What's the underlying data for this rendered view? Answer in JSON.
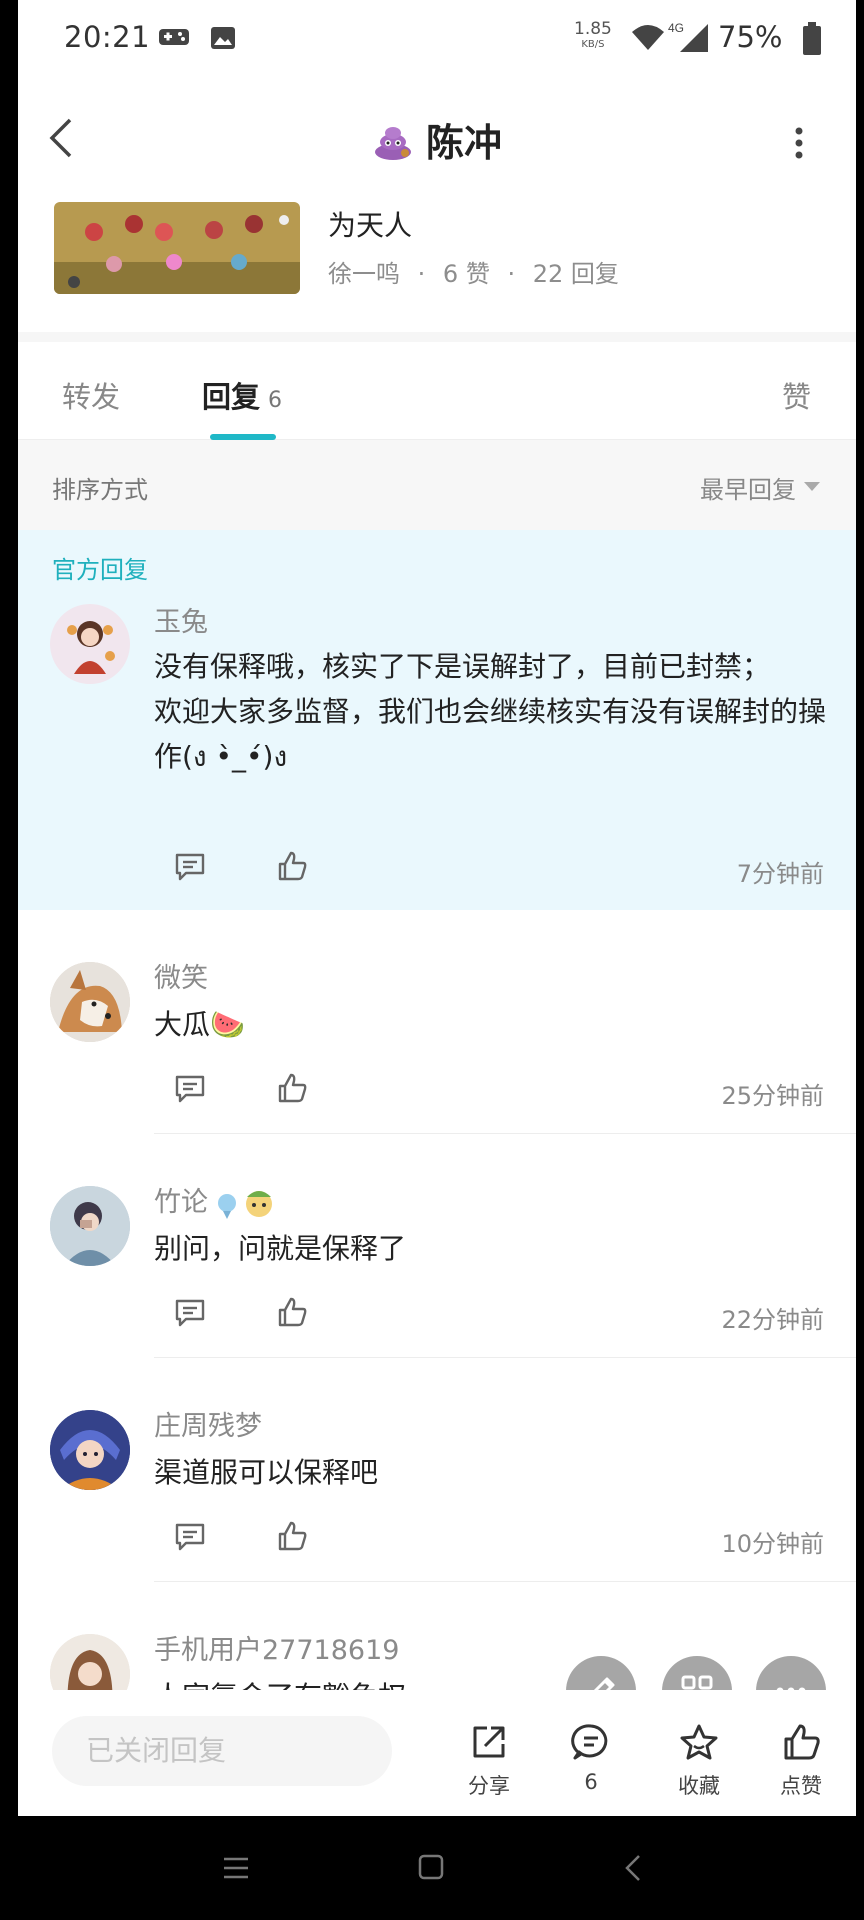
{
  "status_bar": {
    "time": "20:21",
    "net_speed_value": "1.85",
    "net_speed_unit": "KB/S",
    "network_type": "4G",
    "battery": "75%"
  },
  "header": {
    "title": "陈冲",
    "back_icon": "chevron-left-icon",
    "more_icon": "more-vertical-icon"
  },
  "post": {
    "title": "为天人",
    "author": "徐一鸣",
    "likes": "6 赞",
    "replies": "22 回复",
    "meta_sep": "·"
  },
  "tabs": {
    "forward": "转发",
    "reply": "回复",
    "reply_count": "6",
    "like": "赞"
  },
  "sort": {
    "label": "排序方式",
    "value": "最早回复"
  },
  "official_reply": {
    "tag": "官方回复",
    "name": "玉兔",
    "text_line1": "没有保释哦，核实了下是误解封了，目前已封禁；",
    "text_line2": "欢迎大家多监督，我们也会继续核实有没有误解封的操作(ง •̀_•́)ง",
    "time": "7分钟前"
  },
  "comments": [
    {
      "name": "微笑",
      "text": "大瓜🍉",
      "time": "25分钟前"
    },
    {
      "name": "竹论",
      "text": "别问，问就是保释了",
      "time": "22分钟前"
    },
    {
      "name": "庄周残梦",
      "text": "渠道服可以保释吧",
      "time": "10分钟前"
    },
    {
      "name": "手机用户27718619",
      "text": "人家氪金了有豁免权",
      "time": ""
    }
  ],
  "bottom_bar": {
    "reply_placeholder": "已关闭回复",
    "share": "分享",
    "comment_count": "6",
    "favorite": "收藏",
    "like": "点赞"
  },
  "colors": {
    "accent": "#1fb8c7",
    "official_bg": "#eaf8fd",
    "fab_bg": "#a6a6a6"
  }
}
